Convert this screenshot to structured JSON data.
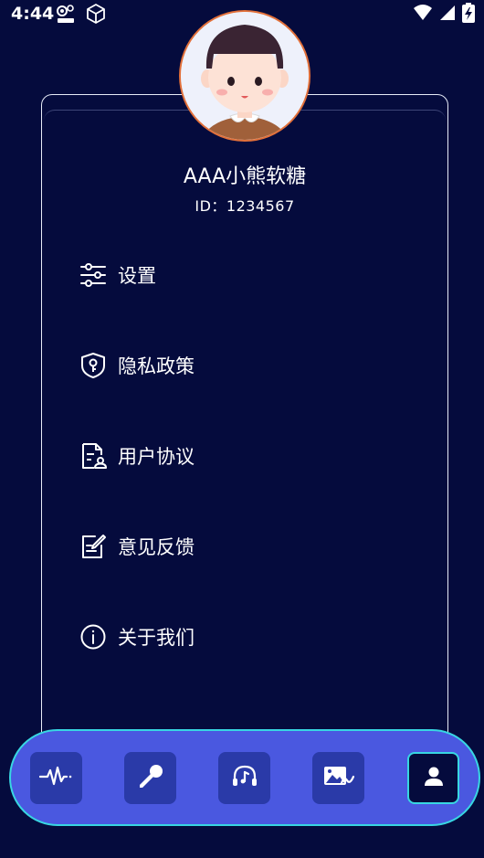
{
  "status_bar": {
    "time": "4:44",
    "app_icons": [
      "bug-badge-icon",
      "cube-icon"
    ],
    "right_icons": [
      "wifi-icon",
      "signal-icon",
      "battery-charging-icon"
    ]
  },
  "profile": {
    "avatar": "avatar-boy",
    "username": "AAA小熊软糖",
    "user_id": "ID：1234567"
  },
  "menu": {
    "items": [
      {
        "label": "设置",
        "icon": "sliders-icon"
      },
      {
        "label": "隐私政策",
        "icon": "shield-key-icon"
      },
      {
        "label": "用户协议",
        "icon": "document-user-icon"
      },
      {
        "label": "意见反馈",
        "icon": "edit-note-icon"
      },
      {
        "label": "关于我们",
        "icon": "info-icon"
      }
    ]
  },
  "bottom_nav": {
    "items": [
      {
        "icon": "waveform-icon",
        "active": false
      },
      {
        "icon": "microphone-icon",
        "active": false
      },
      {
        "icon": "headphone-music-icon",
        "active": false
      },
      {
        "icon": "image-music-icon",
        "active": false
      },
      {
        "icon": "user-icon",
        "active": true
      }
    ]
  },
  "colors": {
    "background": "#050b3d",
    "nav_bar": "#4a58e0",
    "nav_button": "#2a3aa8",
    "accent_border": "#38d6e2",
    "avatar_border": "#e2703a"
  }
}
